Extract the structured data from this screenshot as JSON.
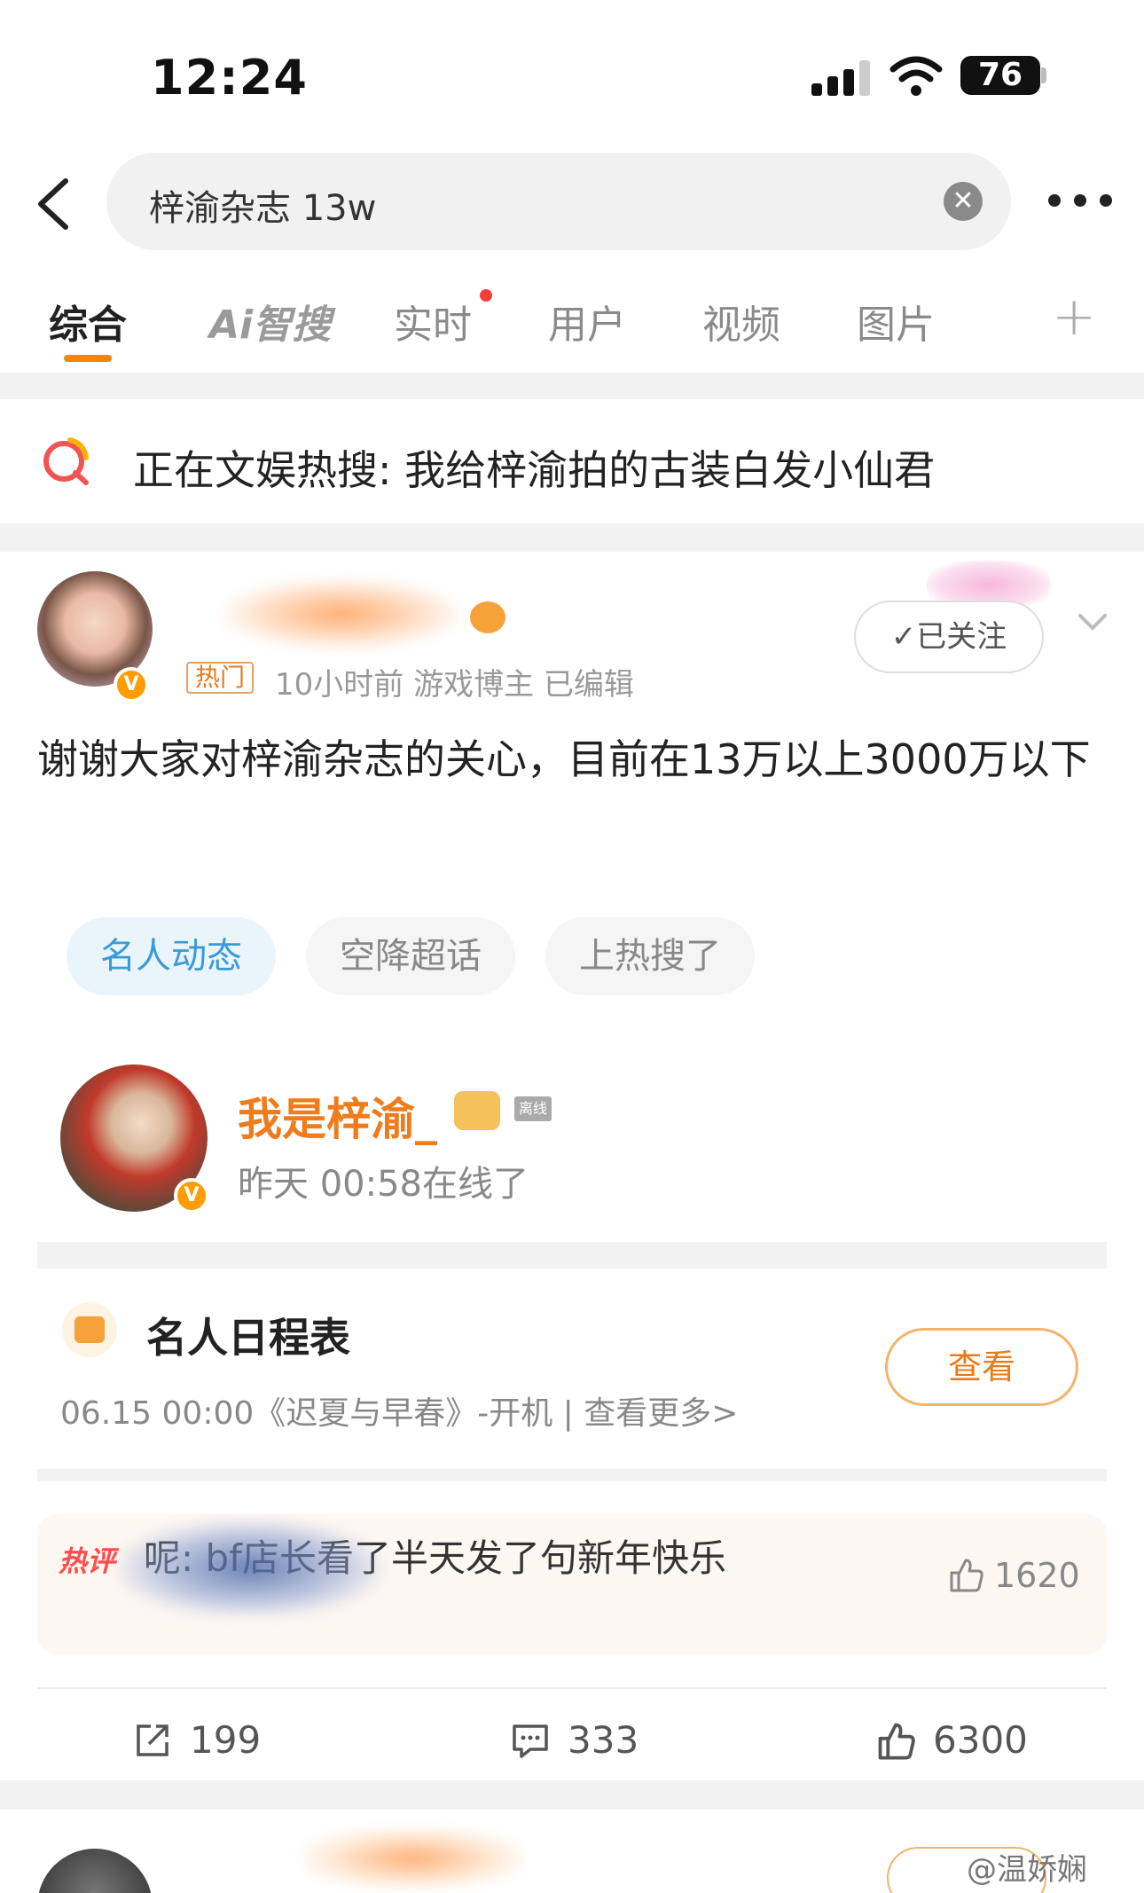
{
  "status_bar": {
    "time": "12:24",
    "battery": "76"
  },
  "search": {
    "query": "梓渝杂志 13w"
  },
  "tabs": [
    {
      "label": "综合"
    },
    {
      "label": "Ai智搜"
    },
    {
      "label": "实时"
    },
    {
      "label": "用户"
    },
    {
      "label": "视频"
    },
    {
      "label": "图片"
    }
  ],
  "hot_search": {
    "text": "正在文娱热搜: 我给梓渝拍的古装白发小仙君"
  },
  "post": {
    "tag": "热门",
    "meta": "10小时前   游戏博主   已编辑",
    "follow_label": "✓已关注",
    "text": "谢谢大家对梓渝杂志的关心，目前在13万以上3000万以下",
    "chips": [
      "名人动态",
      "空降超话",
      "上热搜了"
    ],
    "celebrity": {
      "name": "我是梓渝_",
      "offline": "离线",
      "status": "昨天 00:58在线了"
    },
    "schedule": {
      "title": "名人日程表",
      "line": "06.15 00:00《迟夏与早春》-开机 |  查看更多>",
      "button": "查看"
    },
    "hot_comment": {
      "label": "热评",
      "text": "呢: bf店长看了半天发了句新年快乐",
      "likes": "1620"
    },
    "actions": {
      "reposts": "199",
      "comments": "333",
      "likes": "6300"
    }
  },
  "watermark": "@温娇娴",
  "colors": {
    "accent": "#ff8200",
    "chip_active_bg": "#eaf5fb",
    "chip_active_text": "#3a9ad9",
    "celebrity_name": "#f07b1b"
  }
}
